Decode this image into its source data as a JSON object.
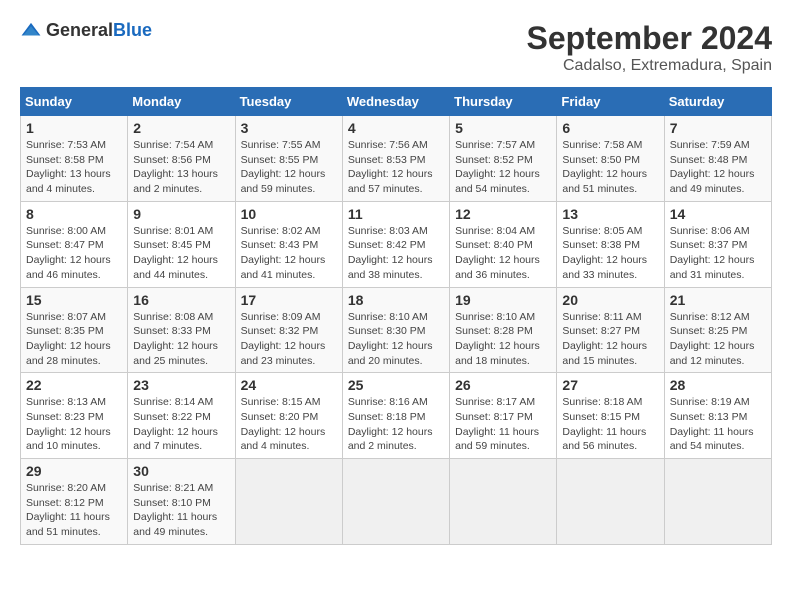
{
  "header": {
    "logo_general": "General",
    "logo_blue": "Blue",
    "month_title": "September 2024",
    "location": "Cadalso, Extremadura, Spain"
  },
  "weekdays": [
    "Sunday",
    "Monday",
    "Tuesday",
    "Wednesday",
    "Thursday",
    "Friday",
    "Saturday"
  ],
  "weeks": [
    [
      {
        "day": "1",
        "info": "Sunrise: 7:53 AM\nSunset: 8:58 PM\nDaylight: 13 hours\nand 4 minutes."
      },
      {
        "day": "2",
        "info": "Sunrise: 7:54 AM\nSunset: 8:56 PM\nDaylight: 13 hours\nand 2 minutes."
      },
      {
        "day": "3",
        "info": "Sunrise: 7:55 AM\nSunset: 8:55 PM\nDaylight: 12 hours\nand 59 minutes."
      },
      {
        "day": "4",
        "info": "Sunrise: 7:56 AM\nSunset: 8:53 PM\nDaylight: 12 hours\nand 57 minutes."
      },
      {
        "day": "5",
        "info": "Sunrise: 7:57 AM\nSunset: 8:52 PM\nDaylight: 12 hours\nand 54 minutes."
      },
      {
        "day": "6",
        "info": "Sunrise: 7:58 AM\nSunset: 8:50 PM\nDaylight: 12 hours\nand 51 minutes."
      },
      {
        "day": "7",
        "info": "Sunrise: 7:59 AM\nSunset: 8:48 PM\nDaylight: 12 hours\nand 49 minutes."
      }
    ],
    [
      {
        "day": "8",
        "info": "Sunrise: 8:00 AM\nSunset: 8:47 PM\nDaylight: 12 hours\nand 46 minutes."
      },
      {
        "day": "9",
        "info": "Sunrise: 8:01 AM\nSunset: 8:45 PM\nDaylight: 12 hours\nand 44 minutes."
      },
      {
        "day": "10",
        "info": "Sunrise: 8:02 AM\nSunset: 8:43 PM\nDaylight: 12 hours\nand 41 minutes."
      },
      {
        "day": "11",
        "info": "Sunrise: 8:03 AM\nSunset: 8:42 PM\nDaylight: 12 hours\nand 38 minutes."
      },
      {
        "day": "12",
        "info": "Sunrise: 8:04 AM\nSunset: 8:40 PM\nDaylight: 12 hours\nand 36 minutes."
      },
      {
        "day": "13",
        "info": "Sunrise: 8:05 AM\nSunset: 8:38 PM\nDaylight: 12 hours\nand 33 minutes."
      },
      {
        "day": "14",
        "info": "Sunrise: 8:06 AM\nSunset: 8:37 PM\nDaylight: 12 hours\nand 31 minutes."
      }
    ],
    [
      {
        "day": "15",
        "info": "Sunrise: 8:07 AM\nSunset: 8:35 PM\nDaylight: 12 hours\nand 28 minutes."
      },
      {
        "day": "16",
        "info": "Sunrise: 8:08 AM\nSunset: 8:33 PM\nDaylight: 12 hours\nand 25 minutes."
      },
      {
        "day": "17",
        "info": "Sunrise: 8:09 AM\nSunset: 8:32 PM\nDaylight: 12 hours\nand 23 minutes."
      },
      {
        "day": "18",
        "info": "Sunrise: 8:10 AM\nSunset: 8:30 PM\nDaylight: 12 hours\nand 20 minutes."
      },
      {
        "day": "19",
        "info": "Sunrise: 8:10 AM\nSunset: 8:28 PM\nDaylight: 12 hours\nand 18 minutes."
      },
      {
        "day": "20",
        "info": "Sunrise: 8:11 AM\nSunset: 8:27 PM\nDaylight: 12 hours\nand 15 minutes."
      },
      {
        "day": "21",
        "info": "Sunrise: 8:12 AM\nSunset: 8:25 PM\nDaylight: 12 hours\nand 12 minutes."
      }
    ],
    [
      {
        "day": "22",
        "info": "Sunrise: 8:13 AM\nSunset: 8:23 PM\nDaylight: 12 hours\nand 10 minutes."
      },
      {
        "day": "23",
        "info": "Sunrise: 8:14 AM\nSunset: 8:22 PM\nDaylight: 12 hours\nand 7 minutes."
      },
      {
        "day": "24",
        "info": "Sunrise: 8:15 AM\nSunset: 8:20 PM\nDaylight: 12 hours\nand 4 minutes."
      },
      {
        "day": "25",
        "info": "Sunrise: 8:16 AM\nSunset: 8:18 PM\nDaylight: 12 hours\nand 2 minutes."
      },
      {
        "day": "26",
        "info": "Sunrise: 8:17 AM\nSunset: 8:17 PM\nDaylight: 11 hours\nand 59 minutes."
      },
      {
        "day": "27",
        "info": "Sunrise: 8:18 AM\nSunset: 8:15 PM\nDaylight: 11 hours\nand 56 minutes."
      },
      {
        "day": "28",
        "info": "Sunrise: 8:19 AM\nSunset: 8:13 PM\nDaylight: 11 hours\nand 54 minutes."
      }
    ],
    [
      {
        "day": "29",
        "info": "Sunrise: 8:20 AM\nSunset: 8:12 PM\nDaylight: 11 hours\nand 51 minutes."
      },
      {
        "day": "30",
        "info": "Sunrise: 8:21 AM\nSunset: 8:10 PM\nDaylight: 11 hours\nand 49 minutes."
      },
      {
        "day": "",
        "info": ""
      },
      {
        "day": "",
        "info": ""
      },
      {
        "day": "",
        "info": ""
      },
      {
        "day": "",
        "info": ""
      },
      {
        "day": "",
        "info": ""
      }
    ]
  ]
}
